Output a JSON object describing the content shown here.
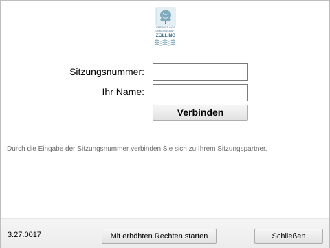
{
  "logo": {
    "line1": "VERWALTUNGS",
    "line2": "GEMEINSCHAFT",
    "name": "ZOLLING",
    "colors": {
      "primary": "#2e6f8e",
      "light": "#a9c9d8"
    }
  },
  "form": {
    "session_label": "Sitzungsnummer:",
    "session_value": "",
    "name_label": "Ihr Name:",
    "name_value": "",
    "connect_label": "Verbinden"
  },
  "hint": "Durch die Eingabe der Sitzungsnummer verbinden Sie sich zu Ihrem Sitzungspartner.",
  "footer": {
    "version": "3.27.0017",
    "elevated_label": "Mit erhöhten Rechten starten",
    "close_label": "Schließen"
  }
}
